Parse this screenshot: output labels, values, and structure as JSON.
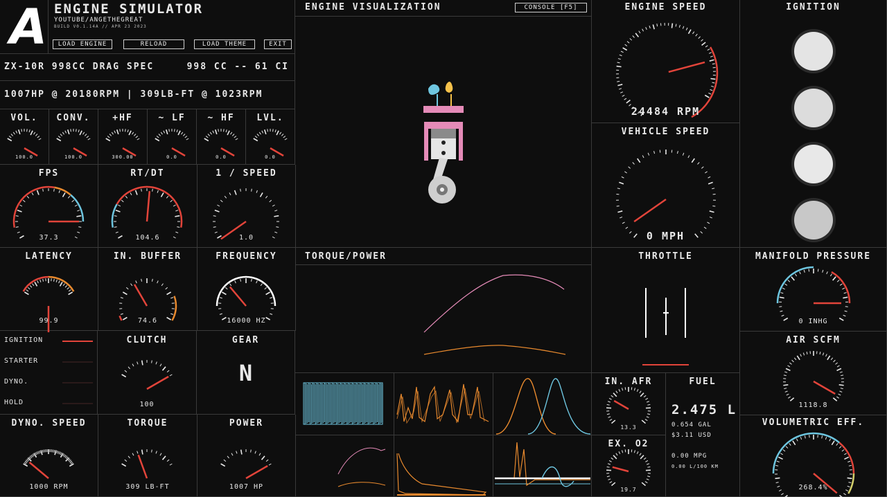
{
  "header": {
    "logo": "A",
    "title": "ENGINE SIMULATOR",
    "subtitle": "YOUTUBE/ANGETHEGREAT",
    "build": "BUILD V0.1.14A // APR 23 2023",
    "buttons": {
      "load_engine": "LOAD ENGINE",
      "reload": "RELOAD",
      "load_theme": "LOAD THEME",
      "exit": "EXIT"
    }
  },
  "engine_info": {
    "name": "ZX-10R 998CC DRAG SPEC",
    "displacement": "998 CC -- 61 CI",
    "peak": "1007HP @ 20180RPM | 309LB-FT @ 1023RPM"
  },
  "mixer": [
    {
      "label": "VOL.",
      "value": "100.0"
    },
    {
      "label": "CONV.",
      "value": "100.0"
    },
    {
      "label": "+HF",
      "value": "300.00"
    },
    {
      "label": "~ LF",
      "value": "0.0"
    },
    {
      "label": "~ HF",
      "value": "0.0"
    },
    {
      "label": "LVL.",
      "value": "0.0"
    }
  ],
  "perf": [
    {
      "label": "FPS",
      "value": "37.3"
    },
    {
      "label": "RT/DT",
      "value": "104.6"
    },
    {
      "label": "1 / SPEED",
      "value": "1.0"
    }
  ],
  "audio": [
    {
      "label": "LATENCY",
      "value": "99.9"
    },
    {
      "label": "IN. BUFFER",
      "value": "74.6"
    },
    {
      "label": "FREQUENCY",
      "value": "16000 HZ"
    }
  ],
  "switches": [
    {
      "label": "IGNITION",
      "on": true
    },
    {
      "label": "STARTER",
      "on": false
    },
    {
      "label": "DYNO.",
      "on": false
    },
    {
      "label": "HOLD",
      "on": false
    }
  ],
  "clutch": {
    "label": "CLUTCH",
    "value": "100"
  },
  "gear": {
    "label": "GEAR",
    "value": "N"
  },
  "bottom_gauges": [
    {
      "label": "DYNO. SPEED",
      "value": "1000 RPM"
    },
    {
      "label": "TORQUE",
      "value": "309 LB-FT"
    },
    {
      "label": "POWER",
      "value": "1007 HP"
    }
  ],
  "visualization": {
    "title": "ENGINE VISUALIZATION",
    "console_button": "CONSOLE [F5]"
  },
  "torque_power": {
    "title": "TORQUE/POWER"
  },
  "engine_speed": {
    "title": "ENGINE SPEED",
    "value": "24484 RPM"
  },
  "vehicle_speed": {
    "title": "VEHICLE SPEED",
    "value": "0 MPH"
  },
  "ignition": {
    "title": "IGNITION"
  },
  "throttle": {
    "title": "THROTTLE"
  },
  "manifold": {
    "title": "MANIFOLD PRESSURE",
    "value": "0 INHG"
  },
  "air": {
    "title": "AIR SCFM",
    "value": "1118.8"
  },
  "in_afr": {
    "title": "IN. AFR",
    "value": "13.3"
  },
  "ex_o2": {
    "title": "EX. O2",
    "value": "19.7"
  },
  "fuel": {
    "title": "FUEL",
    "liters": "2.475 L",
    "gal": "0.654 GAL",
    "usd": "$3.11 USD",
    "mpg": "0.00 MPG",
    "l100": "0.00 L/100 KM"
  },
  "vol_eff": {
    "title": "VOLUMETRIC EFF.",
    "value": "268.4%"
  },
  "colors": {
    "bg": "#0e0e0e",
    "red": "#e2443a",
    "orange": "#e98a2e",
    "blue": "#6ec6e0",
    "pink": "#e58bb8",
    "border": "#3a3a3a"
  }
}
